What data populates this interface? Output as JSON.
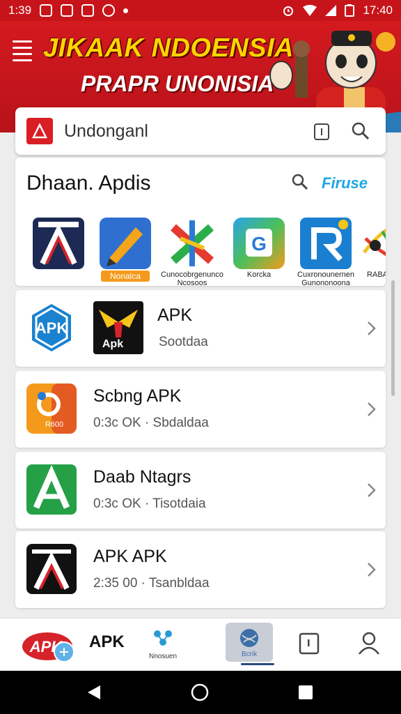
{
  "status_bar": {
    "left_time": "1:39",
    "right_time": "17:40"
  },
  "banner": {
    "title": "JIKAAK NDOENSIA",
    "subtitle": "PRAPR UNONISIA"
  },
  "search": {
    "value": "Undonganl"
  },
  "featured": {
    "title": "Dhaan. Apdis",
    "link": "Firuse",
    "apps": [
      {
        "caption": "",
        "icon": "a-logo-icon"
      },
      {
        "caption": "Nonalca",
        "icon": "pencil-app-icon"
      },
      {
        "caption": "Cunocobrgenunco Ncosoos",
        "icon": "x-cross-app-icon"
      },
      {
        "caption": "Korcka",
        "icon": "g-app-icon"
      },
      {
        "caption": "Cuxronounernen Gunononoona",
        "icon": "r-app-icon"
      },
      {
        "caption": "RABAD",
        "icon": "colorful-app-icon"
      }
    ]
  },
  "list": [
    {
      "title": "APK",
      "meta": "Sootdaa",
      "icon": "apk-badge-icon"
    },
    {
      "title": "Scbng APK",
      "meta": "0:3c OK  ·  Sbdaldaa",
      "icon": "ring-app-icon"
    },
    {
      "title": "Daab Ntagrs",
      "meta": "0:3c OK  ·  Tisotdaia",
      "icon": "green-a-app-icon"
    },
    {
      "title": "APK APK",
      "meta": "2:35 00  ·  Tsanbldaa",
      "icon": "black-a-app-icon"
    }
  ],
  "bottom_nav": {
    "apk_label": "APK",
    "item_a_label": "Nnosuen",
    "active_label": "Bcrik"
  },
  "colors": {
    "brand_red": "#c7141a",
    "accent_blue": "#1ea7e4",
    "title_yellow": "#ffd400"
  }
}
